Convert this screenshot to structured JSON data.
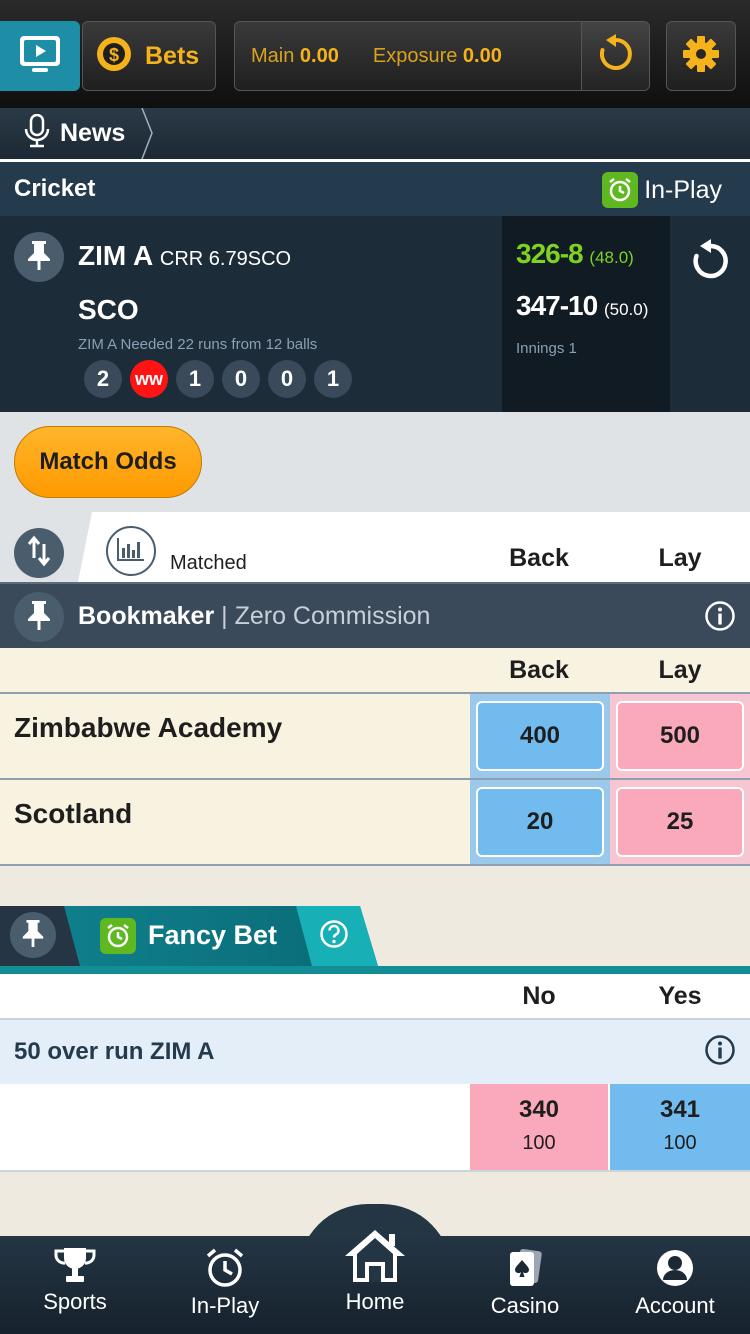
{
  "header": {
    "bets_label": "Bets",
    "main_label": "Main",
    "main_value": "0.00",
    "exposure_label": "Exposure",
    "exposure_value": "0.00"
  },
  "news": {
    "label": "News"
  },
  "sport": {
    "title": "Cricket",
    "inplay_label": "In-Play"
  },
  "score": {
    "team1": "ZIM A",
    "crr": "CRR 6.79SCO",
    "team2": "SCO",
    "needed": "ZIM A Needed 22 runs from 12 balls",
    "balls": [
      "2",
      "ww",
      "1",
      "0",
      "0",
      "1"
    ],
    "score1": "326-8",
    "overs1": "(48.0)",
    "score2": "347-10",
    "overs2": "(50.0)",
    "innings": "Innings 1"
  },
  "match_odds": {
    "tab_label": "Match Odds",
    "matched_label": "Matched",
    "back_label": "Back",
    "lay_label": "Lay"
  },
  "bookmaker": {
    "title": "Bookmaker",
    "subtitle": "| Zero Commission",
    "back_label": "Back",
    "lay_label": "Lay",
    "rows": [
      {
        "name": "Zimbabwe Academy",
        "back": "400",
        "lay": "500"
      },
      {
        "name": "Scotland",
        "back": "20",
        "lay": "25"
      }
    ]
  },
  "fancy": {
    "title": "Fancy Bet",
    "no_label": "No",
    "yes_label": "Yes",
    "market_name": "50 over run ZIM A",
    "no_odd": "340",
    "no_vol": "100",
    "yes_odd": "341",
    "yes_vol": "100"
  },
  "nav": {
    "sports": "Sports",
    "inplay": "In-Play",
    "home": "Home",
    "casino": "Casino",
    "account": "Account"
  },
  "colors": {
    "accent_orange": "#f5b21b",
    "back_blue": "#72bbef",
    "lay_pink": "#faa9ba",
    "inplay_green": "#5fb820",
    "score_green": "#7ed321",
    "teal": "#128d96"
  },
  "icons": [
    "tv-icon",
    "coin-icon",
    "refresh-icon",
    "gear-icon",
    "microphone-icon",
    "alarm-clock-icon",
    "pin-icon",
    "sort-arrows-icon",
    "bar-chart-icon",
    "info-icon",
    "help-icon",
    "trophy-icon",
    "home-icon",
    "cards-icon",
    "user-icon"
  ]
}
